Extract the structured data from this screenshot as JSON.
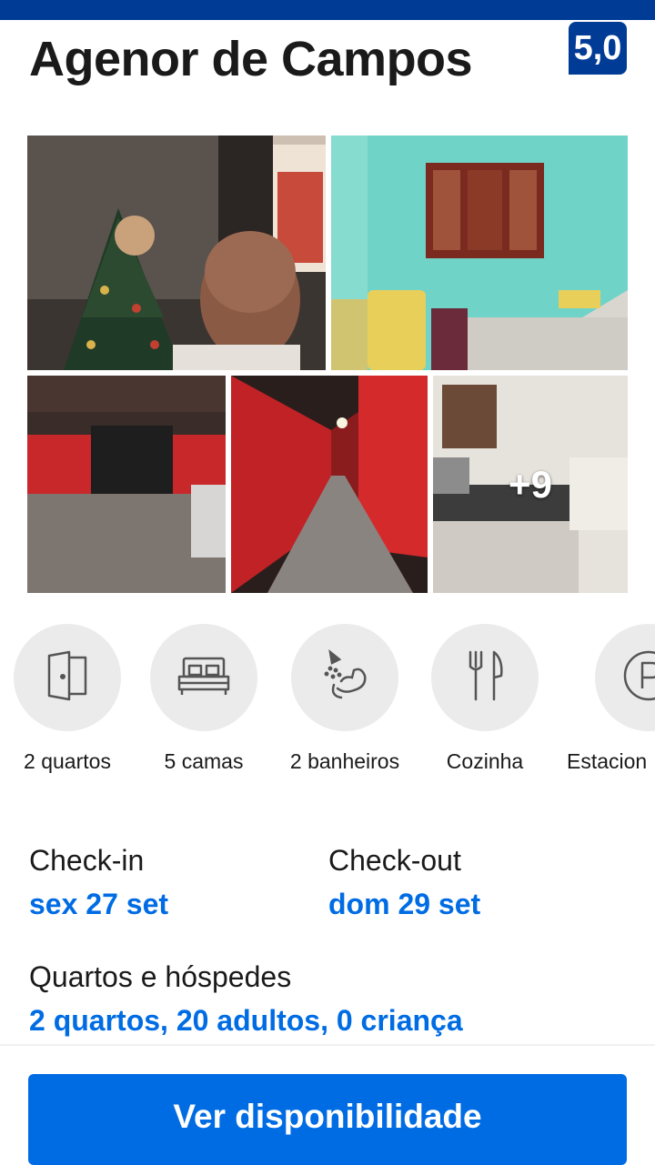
{
  "header": {
    "title": "Agenor de Campos",
    "score": "5,0"
  },
  "gallery": {
    "more_count": "+9"
  },
  "amenities": [
    {
      "icon": "door-icon",
      "label": "2 quartos"
    },
    {
      "icon": "bed-icon",
      "label": "5 camas"
    },
    {
      "icon": "shower-icon",
      "label": "2 banheiros"
    },
    {
      "icon": "cutlery-icon",
      "label": "Cozinha"
    },
    {
      "icon": "parking-icon",
      "label": "Estacion"
    }
  ],
  "dates": {
    "checkin_label": "Check-in",
    "checkin_value": "sex 27 set",
    "checkout_label": "Check-out",
    "checkout_value": "dom 29 set"
  },
  "guests": {
    "label": "Quartos e hóspedes",
    "value": "2 quartos, 20 adultos, 0 criança"
  },
  "cta": {
    "label": "Ver disponibilidade"
  },
  "colors": {
    "brand_dark": "#003b95",
    "accent": "#006ce4"
  }
}
